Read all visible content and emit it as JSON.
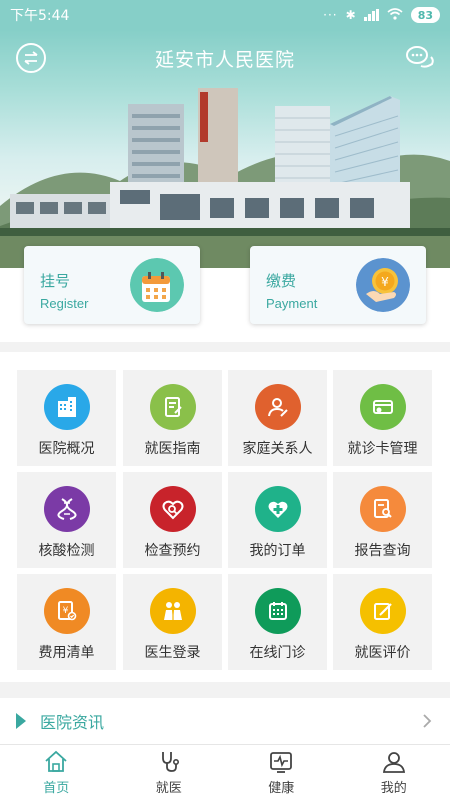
{
  "status": {
    "time": "下午5:44",
    "battery": "83"
  },
  "header": {
    "title": "延安市人民医院"
  },
  "quick": [
    {
      "zh": "挂号",
      "en": "Register"
    },
    {
      "zh": "缴费",
      "en": "Payment"
    }
  ],
  "grid": [
    {
      "label": "医院概况",
      "icon": "building-icon",
      "color": "#29a8e8"
    },
    {
      "label": "就医指南",
      "icon": "guide-icon",
      "color": "#8ac04a"
    },
    {
      "label": "家庭关系人",
      "icon": "person-edit-icon",
      "color": "#e0612e"
    },
    {
      "label": "就诊卡管理",
      "icon": "card-icon",
      "color": "#6fbe45"
    },
    {
      "label": "核酸检测",
      "icon": "dna-icon",
      "color": "#7b3aa6"
    },
    {
      "label": "检查预约",
      "icon": "heart-search-icon",
      "color": "#c8232b"
    },
    {
      "label": "我的订单",
      "icon": "medical-cross-icon",
      "color": "#1fb28a"
    },
    {
      "label": "报告查询",
      "icon": "report-search-icon",
      "color": "#f58a3c"
    },
    {
      "label": "费用清单",
      "icon": "fee-list-icon",
      "color": "#f08a24"
    },
    {
      "label": "医生登录",
      "icon": "doctor-icon",
      "color": "#f4b400"
    },
    {
      "label": "在线门诊",
      "icon": "calendar-icon",
      "color": "#0f9b5a"
    },
    {
      "label": "就医评价",
      "icon": "edit-icon",
      "color": "#f5c000"
    }
  ],
  "news": {
    "title": "医院资讯"
  },
  "tabs": [
    {
      "label": "首页",
      "icon": "home-icon"
    },
    {
      "label": "就医",
      "icon": "stethoscope-icon"
    },
    {
      "label": "健康",
      "icon": "health-monitor-icon"
    },
    {
      "label": "我的",
      "icon": "user-icon"
    }
  ],
  "colors": {
    "accent": "#3aa8a0",
    "header": "#86cfc8"
  }
}
